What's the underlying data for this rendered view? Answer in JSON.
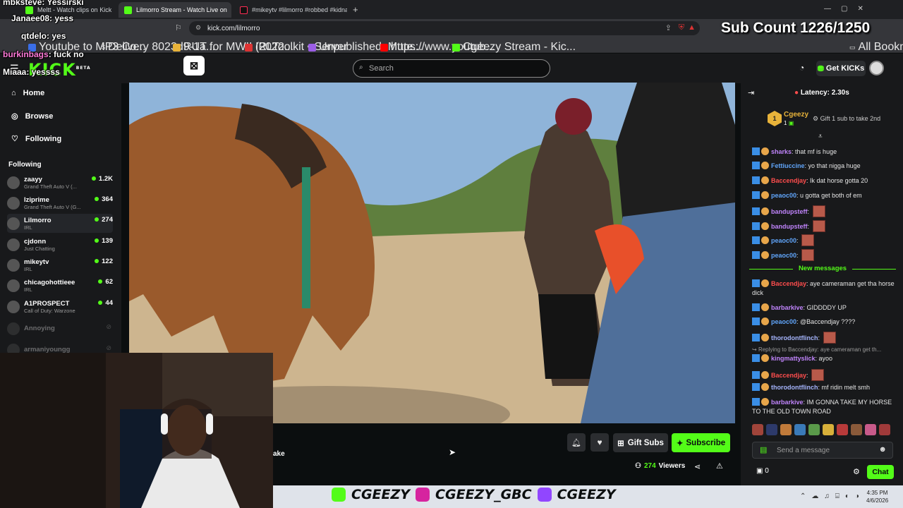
{
  "browser": {
    "tabs": [
      {
        "label": "Meltt - Watch clips on Kick",
        "active": false
      },
      {
        "label": "Lilmorro Stream - Watch Live on",
        "active": true
      },
      {
        "label": "#mikeytv #lilmorro #robbed #kidnap",
        "active": false
      }
    ],
    "new_tab": "+",
    "url": "kick.com/lilmorro",
    "bookmarks": [
      "Youtube to MP3 Co...",
      "Delivery 8023d9-1a...",
      "RUT for MWII (2022...",
      "IRLToolkit • Server",
      "Unpublished, Mute...",
      "https://www.youtub...",
      "Cgeezy Stream - Kic..."
    ],
    "all_bookmarks": "All Bookmarks"
  },
  "overlay_chat": [
    {
      "user": "mbksteve",
      "text": "Yessirski",
      "color": "#ffffff"
    },
    {
      "user": "Janaee08",
      "text": "yess",
      "color": "#ffffff"
    },
    {
      "user": "qtdelo",
      "text": "yes",
      "color": "#ffffff"
    },
    {
      "user": "burkinbags",
      "text": "fuck no",
      "color": "#ff7ad9"
    },
    {
      "user": "Miaaa",
      "text": "yessss",
      "color": "#ffffff"
    }
  ],
  "sub_count": "Sub Count  1226/1250",
  "kick": {
    "logo": "KICK",
    "logo_beta": "BETA",
    "search_placeholder": "Search",
    "get_kicks": "Get KICKs"
  },
  "sidebar": {
    "nav": [
      "Home",
      "Browse",
      "Following"
    ],
    "following_header": "Following",
    "following": [
      {
        "name": "zaayy",
        "game": "Grand Theft Auto V (...",
        "viewers": "1.2K",
        "live": true
      },
      {
        "name": "lziprime",
        "game": "Grand Theft Auto V (G...",
        "viewers": "364",
        "live": true
      },
      {
        "name": "Lilmorro",
        "game": "IRL",
        "viewers": "274",
        "live": true
      },
      {
        "name": "cjdonn",
        "game": "Just Chatting",
        "viewers": "139",
        "live": true
      },
      {
        "name": "mikeytv",
        "game": "IRL",
        "viewers": "122",
        "live": true
      },
      {
        "name": "chicagohottieee",
        "game": "IRL",
        "viewers": "62",
        "live": true
      },
      {
        "name": "A1PROSPECT",
        "game": "Call of Duty: Warzone",
        "viewers": "44",
        "live": true
      },
      {
        "name": "Annoying",
        "game": "",
        "viewers": "",
        "live": false
      },
      {
        "name": "armaniyoungg",
        "game": "",
        "viewers": "",
        "live": false
      }
    ]
  },
  "stream": {
    "title_fragment": "ake",
    "gift_subs": "Gift Subs",
    "subscribe": "Subscribe",
    "viewers": "274",
    "viewers_label": "Viewers"
  },
  "socials": [
    "CGEEZY",
    "CGEEZY_GBC",
    "CGEEZY"
  ],
  "clock": {
    "time": "4:35 PM",
    "date": "4/6/2026"
  },
  "chat": {
    "latency": "Latency: 2.30s",
    "pinned_user": "Cgeezy",
    "pinned_rank": "1",
    "pinned_count": "1",
    "gift_hint": "Gift 1 sub to take 2nd",
    "messages": [
      {
        "user": "sharks",
        "color": "#c084fc",
        "text": "that mf is huge",
        "emote": false
      },
      {
        "user": "Fettiuccine",
        "color": "#60a5fa",
        "text": "yo that nigga huge",
        "emote": false
      },
      {
        "user": "Baccendjay",
        "color": "#ff4d4d",
        "text": "Ik dat horse gotta 20",
        "emote": false
      },
      {
        "user": "peaoc00",
        "color": "#60a5fa",
        "text": "u gotta get both of em",
        "emote": false
      },
      {
        "user": "bandupsteff",
        "color": "#c084fc",
        "text": "",
        "emote": true
      },
      {
        "user": "bandupsteff",
        "color": "#c084fc",
        "text": "",
        "emote": true
      },
      {
        "user": "peaoc00",
        "color": "#60a5fa",
        "text": "",
        "emote": true
      },
      {
        "user": "peaoc00",
        "color": "#60a5fa",
        "text": "",
        "emote": true
      }
    ],
    "new_messages": "New messages",
    "messages2": [
      {
        "user": "Baccendjay",
        "color": "#ff4d4d",
        "text": "aye cameraman get tha horse dick",
        "emote": false
      },
      {
        "user": "barbarkive",
        "color": "#c084fc",
        "text": "GIDDDDY UP",
        "emote": false
      },
      {
        "user": "peaoc00",
        "color": "#60a5fa",
        "text": "@Baccendjay ????",
        "emote": false
      },
      {
        "user": "thorodontflinch",
        "color": "#a5b4fc",
        "text": "",
        "emote": true
      }
    ],
    "reply_context": "Replying to Baccendjay: aye cameraman get th...",
    "messages3": [
      {
        "user": "kingmattyslick",
        "color": "#c084fc",
        "text": "ayoo",
        "emote": false
      },
      {
        "user": "Baccendjay",
        "color": "#ff4d4d",
        "text": "",
        "emote": true
      },
      {
        "user": "thorodontflinch",
        "color": "#a5b4fc",
        "text": "mf ridin melt smh",
        "emote": false
      },
      {
        "user": "barbarkive",
        "color": "#c084fc",
        "text": "IM GONNA TAKE MY HORSE TO THE OLD TOWN ROAD",
        "emote": false
      }
    ],
    "input_placeholder": "Send a message",
    "kicks_count": "0",
    "chat_button": "Chat"
  }
}
